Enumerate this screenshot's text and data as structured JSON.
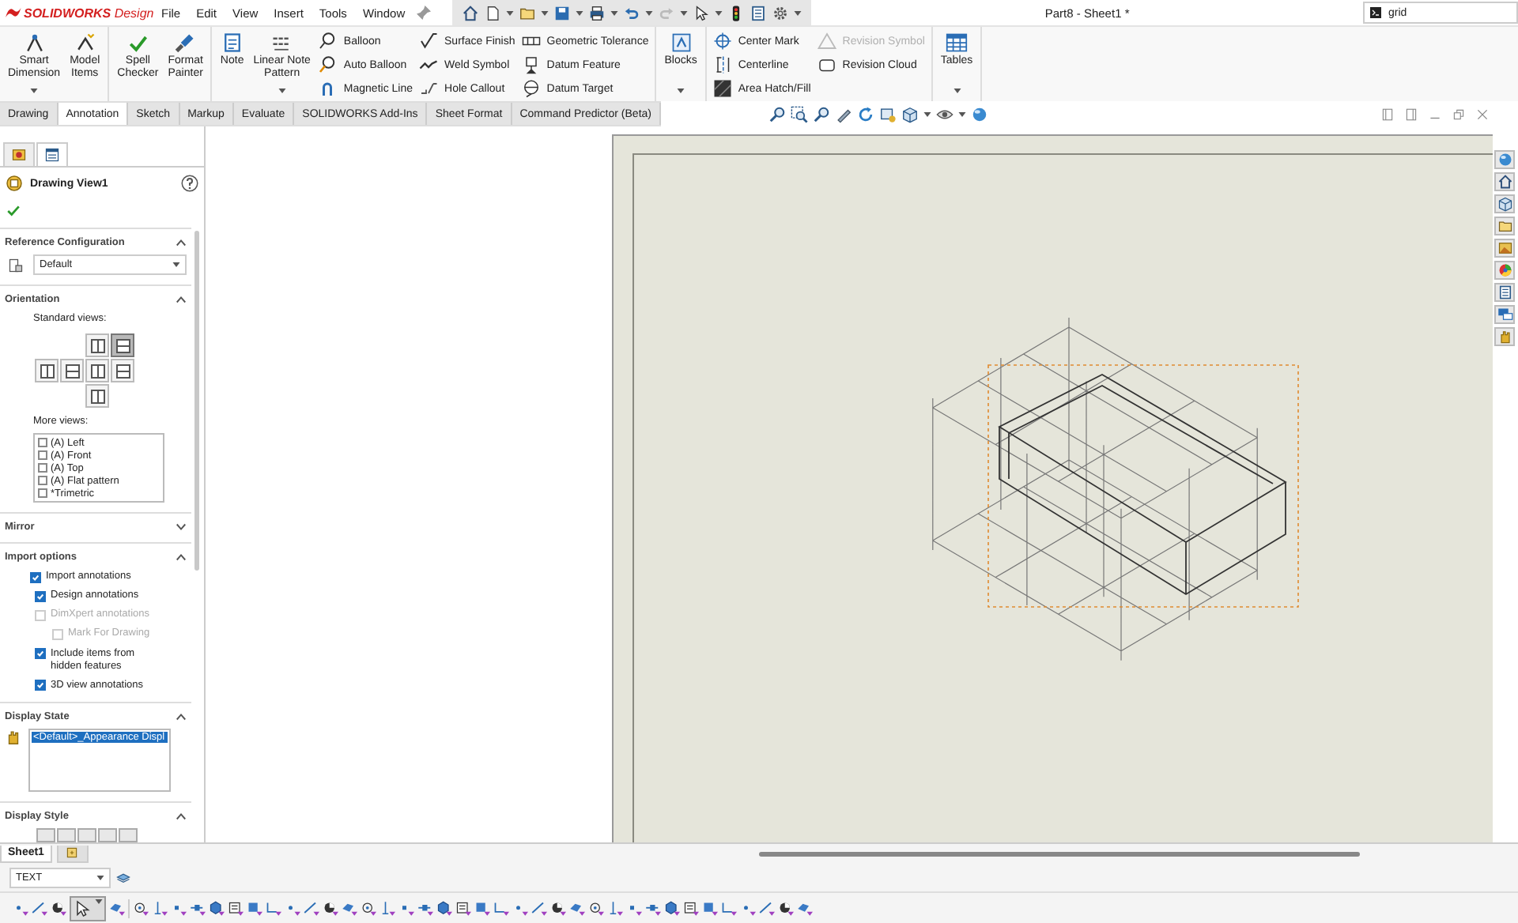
{
  "app_title": "**SOLIDWORKS** Design",
  "menu": [
    "File",
    "Edit",
    "View",
    "Insert",
    "Tools",
    "Window"
  ],
  "document_title": "Part8 - Sheet1 *",
  "search": {
    "value": "grid"
  },
  "ribbon": {
    "groups": [
      {
        "items": [
          {
            "kind": "large",
            "label": "Smart\nDimension",
            "dropdown": true
          },
          {
            "kind": "large",
            "label": "Model\nItems",
            "dropdown": false
          }
        ]
      },
      {
        "items": [
          {
            "kind": "large",
            "label": "Spell\nChecker",
            "dropdown": false
          },
          {
            "kind": "large",
            "label": "Format\nPainter",
            "dropdown": false
          }
        ]
      },
      {
        "items": [
          {
            "kind": "large",
            "label": "Note",
            "dropdown": false
          },
          {
            "kind": "large",
            "label": "Linear Note\nPattern",
            "dropdown": true
          },
          {
            "kind": "stack",
            "buttons": [
              {
                "label": "Balloon",
                "disabled": false
              },
              {
                "label": "Auto Balloon",
                "disabled": false
              },
              {
                "label": "Magnetic Line",
                "disabled": false
              }
            ]
          },
          {
            "kind": "stack",
            "buttons": [
              {
                "label": "Surface Finish",
                "disabled": false
              },
              {
                "label": "Weld Symbol",
                "disabled": false
              },
              {
                "label": "Hole Callout",
                "disabled": false
              }
            ]
          },
          {
            "kind": "stack",
            "buttons": [
              {
                "label": "Geometric Tolerance",
                "disabled": false
              },
              {
                "label": "Datum Feature",
                "disabled": false
              },
              {
                "label": "Datum Target",
                "disabled": false
              }
            ]
          }
        ]
      },
      {
        "items": [
          {
            "kind": "large",
            "label": "Blocks",
            "dropdown": true
          }
        ]
      },
      {
        "items": [
          {
            "kind": "stack",
            "buttons": [
              {
                "label": "Center Mark",
                "disabled": false
              },
              {
                "label": "Centerline",
                "disabled": false
              },
              {
                "label": "Area Hatch/Fill",
                "disabled": false
              }
            ]
          },
          {
            "kind": "stack",
            "buttons": [
              {
                "label": "Revision Symbol",
                "disabled": true
              },
              {
                "label": "Revision Cloud",
                "disabled": false
              }
            ]
          }
        ]
      },
      {
        "items": [
          {
            "kind": "large",
            "label": "Tables",
            "dropdown": true
          }
        ]
      }
    ]
  },
  "tabs": [
    {
      "label": "Drawing",
      "selected": false
    },
    {
      "label": "Annotation",
      "selected": true
    },
    {
      "label": "Sketch",
      "selected": false
    },
    {
      "label": "Markup",
      "selected": false
    },
    {
      "label": "Evaluate",
      "selected": false
    },
    {
      "label": "SOLIDWORKS Add-Ins",
      "selected": false
    },
    {
      "label": "Sheet Format",
      "selected": false
    },
    {
      "label": "Command Predictor (Beta)",
      "selected": false
    }
  ],
  "property_manager": {
    "tabs": [
      {
        "selected": false
      },
      {
        "selected": true
      }
    ],
    "title": "Drawing View1",
    "sections": [
      {
        "kind": "config",
        "title": "Reference Configuration",
        "expanded": true,
        "value": "Default"
      },
      {
        "kind": "orientation",
        "title": "Orientation",
        "expanded": true,
        "standard_views_label": "Standard views:",
        "standard_views": [
          {
            "selected": false
          },
          {
            "selected": true
          },
          {
            "selected": false
          },
          {
            "selected": false
          },
          {
            "selected": false
          },
          {
            "selected": false
          },
          {
            "selected": false
          }
        ],
        "more_views_label": "More views:",
        "more_views": [
          {
            "label": "(A) Left",
            "checked": false
          },
          {
            "label": "(A) Front",
            "checked": false
          },
          {
            "label": "(A) Top",
            "checked": false
          },
          {
            "label": "(A) Flat pattern",
            "checked": false
          },
          {
            "label": "*Trimetric",
            "checked": false
          }
        ]
      },
      {
        "kind": "plain",
        "title": "Mirror",
        "expanded": false
      },
      {
        "kind": "checkboxes",
        "title": "Import options",
        "expanded": true,
        "options": [
          {
            "label": "Import annotations",
            "checked": true,
            "disabled": false,
            "children": [
              {
                "label": "Design annotations",
                "checked": true,
                "disabled": false
              },
              {
                "label": "DimXpert annotations",
                "checked": false,
                "disabled": true,
                "children": [
                  {
                    "label": "Mark For Drawing",
                    "checked": false,
                    "disabled": true
                  }
                ]
              },
              {
                "label": "Include items from\nhidden features",
                "checked": true,
                "disabled": false
              },
              {
                "label": "3D view annotations",
                "checked": true,
                "disabled": false
              }
            ]
          }
        ]
      },
      {
        "kind": "list",
        "title": "Display State",
        "expanded": true,
        "items": [
          {
            "label": "<Default>_Appearance Displ",
            "selected": true
          }
        ]
      },
      {
        "kind": "style",
        "title": "Display Style",
        "expanded": true
      }
    ]
  },
  "layer": {
    "value": "TEXT"
  },
  "sheet_tabs": [
    {
      "label": "Sheet1",
      "selected": true
    }
  ]
}
